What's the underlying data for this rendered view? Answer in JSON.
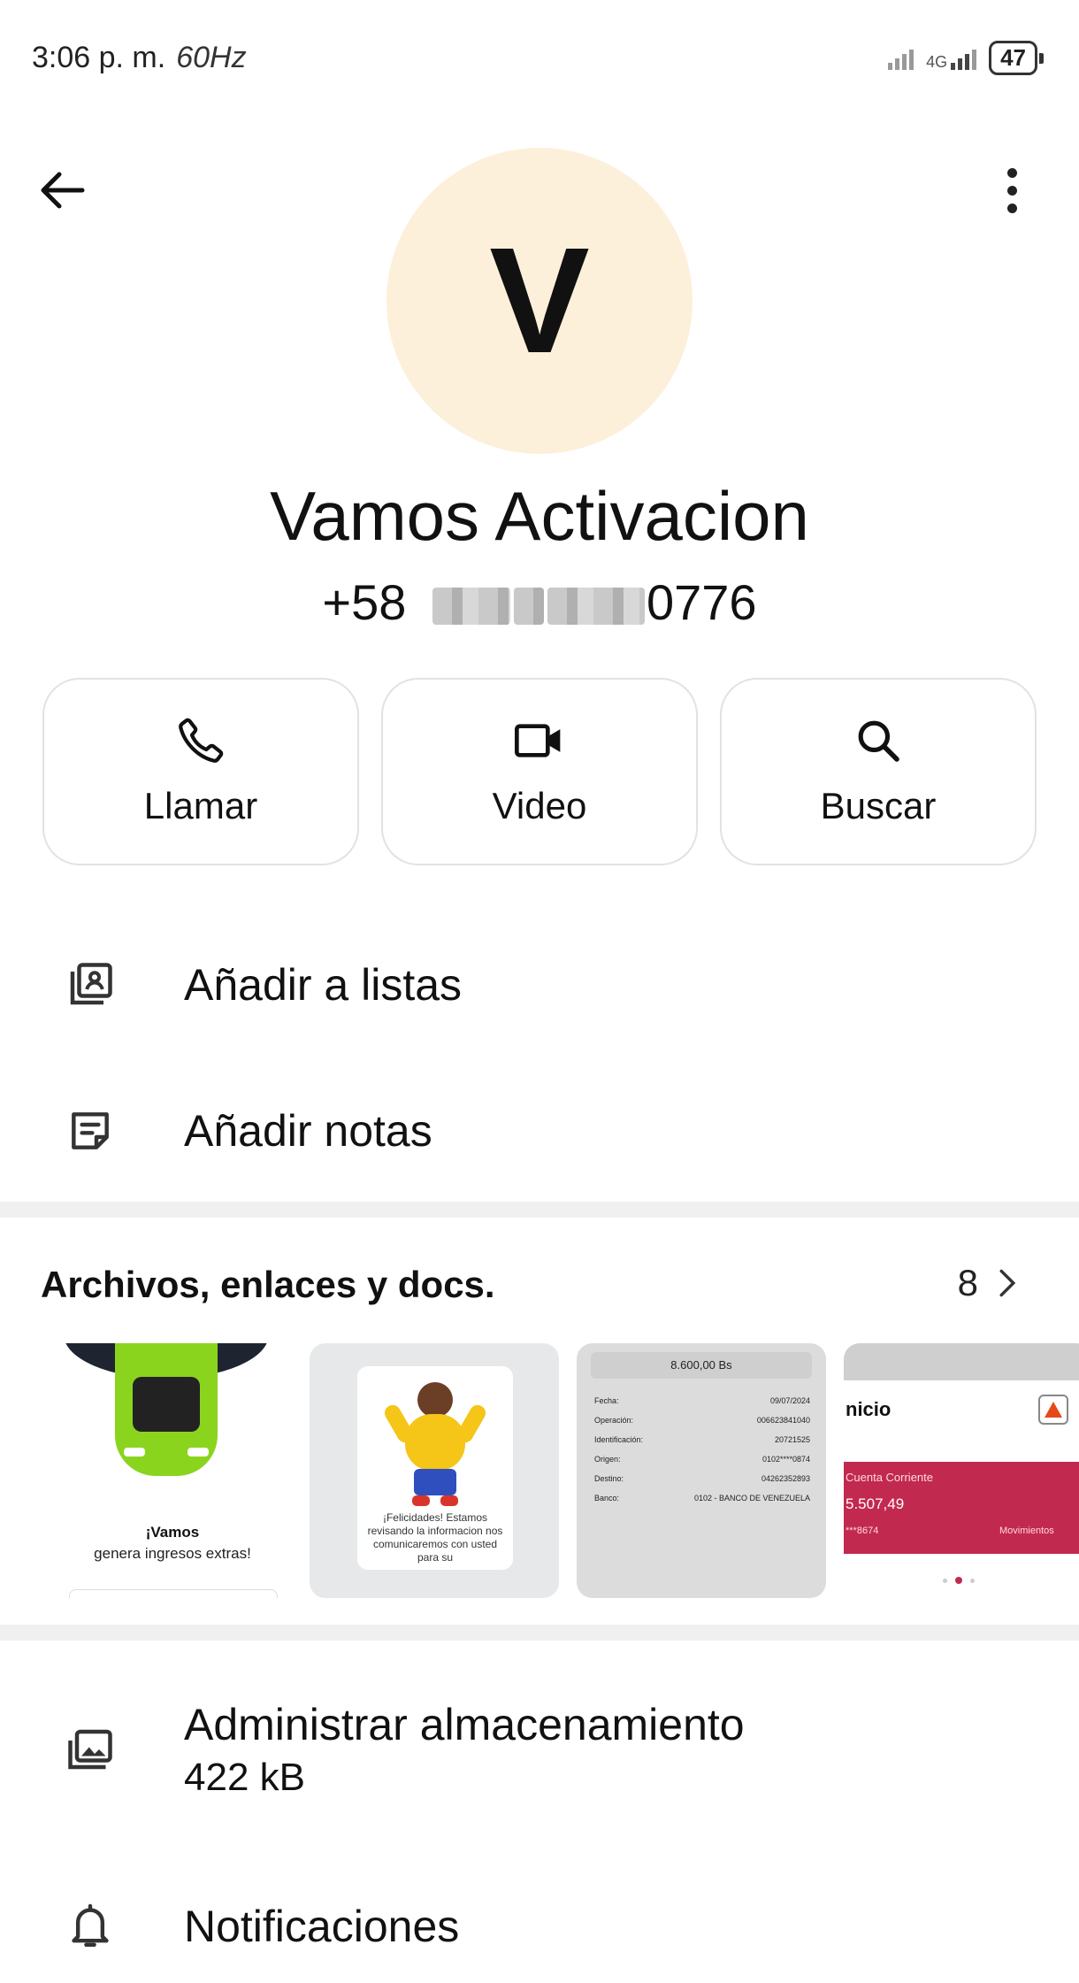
{
  "status_bar": {
    "time": "3:06 p. m.",
    "refresh": "60Hz",
    "network": "4G",
    "battery": "47"
  },
  "contact": {
    "initial": "V",
    "name": "Vamos Activacion",
    "phone_prefix": "+58",
    "phone_suffix": "0776",
    "avatar_color": "#fdf0da"
  },
  "actions": [
    {
      "label": "Llamar",
      "icon": "phone-icon"
    },
    {
      "label": "Video",
      "icon": "video-icon"
    },
    {
      "label": "Buscar",
      "icon": "search-icon"
    }
  ],
  "options": {
    "add_to_lists": "Añadir a listas",
    "add_notes": "Añadir notas"
  },
  "media": {
    "title": "Archivos, enlaces y docs.",
    "count": "8",
    "thumb1": {
      "line1": "¡Vamos",
      "line2": "genera ingresos extras!"
    },
    "thumb2": {
      "text": "¡Felicidades! Estamos revisando la informacion nos comunicaremos con usted para su"
    },
    "thumb3": {
      "amount": "8.600,00 Bs",
      "rows": [
        {
          "label": "Fecha:",
          "value": "09/07/2024"
        },
        {
          "label": "Operación:",
          "value": "006623841040"
        },
        {
          "label": "Identificación:",
          "value": "20721525"
        },
        {
          "label": "Origen:",
          "value": "0102****0874"
        },
        {
          "label": "Destino:",
          "value": "04262352893"
        },
        {
          "label": "Banco:",
          "value": "0102 - BANCO DE VENEZUELA"
        }
      ]
    },
    "thumb4": {
      "title": "nicio",
      "account": "Cuenta Corriente",
      "balance": "5.507,49",
      "number": "***8674",
      "movements": "Movimientos"
    }
  },
  "storage": {
    "label": "Administrar almacenamiento",
    "size": "422 kB"
  },
  "notifications": {
    "label": "Notificaciones"
  }
}
